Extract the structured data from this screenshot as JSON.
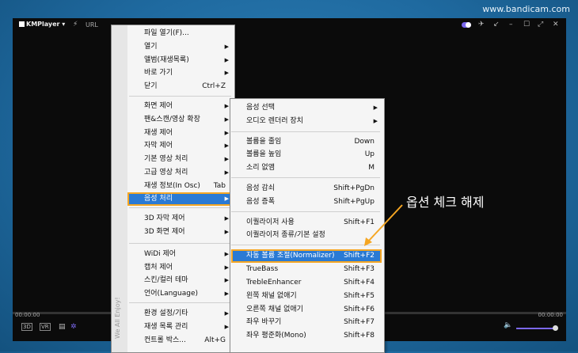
{
  "watermark": "www.bandicam.com",
  "titlebar": {
    "app_name": "KMPlayer",
    "url_label": "URL"
  },
  "player": {
    "time_elapsed": "00:00:00",
    "time_total": "00:00:00",
    "btn_3d": "3D",
    "btn_vr": "VR",
    "volume_fraction": 0.95,
    "accent_color": "#7b68ee"
  },
  "main_menu": {
    "vertical_text": "We All Enjoy!",
    "items": [
      {
        "label": "파일 열기(F)...",
        "shortcut": "",
        "arrow": ""
      },
      {
        "label": "열기",
        "shortcut": "",
        "arrow": "▶"
      },
      {
        "label": "앨범(재생목록)",
        "shortcut": "",
        "arrow": "▶"
      },
      {
        "label": "바로 가기",
        "shortcut": "",
        "arrow": "▶"
      },
      {
        "label": "닫기",
        "shortcut": "Ctrl+Z",
        "arrow": ""
      },
      {
        "label": "화면 제어",
        "shortcut": "",
        "arrow": "▶"
      },
      {
        "label": "팬&스캔/영상 확장",
        "shortcut": "",
        "arrow": "▶"
      },
      {
        "label": "재생 제어",
        "shortcut": "",
        "arrow": "▶"
      },
      {
        "label": "자막 제어",
        "shortcut": "",
        "arrow": "▶"
      },
      {
        "label": "기본 영상 처리",
        "shortcut": "",
        "arrow": "▶"
      },
      {
        "label": "고급 영상 처리",
        "shortcut": "",
        "arrow": "▶"
      },
      {
        "label": "재생 정보(In Osc)",
        "shortcut": "Tab",
        "arrow": ""
      },
      {
        "label": "음성 처리",
        "shortcut": "",
        "arrow": "▶"
      },
      {
        "label": "3D 자막 제어",
        "shortcut": "",
        "arrow": "▶"
      },
      {
        "label": "3D 화면 제어",
        "shortcut": "",
        "arrow": "▶"
      },
      {
        "label": "WiDi 제어",
        "shortcut": "",
        "arrow": "▶"
      },
      {
        "label": "캡처 제어",
        "shortcut": "",
        "arrow": "▶"
      },
      {
        "label": "스킨/컬러 테마",
        "shortcut": "",
        "arrow": "▶"
      },
      {
        "label": "언어(Language)",
        "shortcut": "",
        "arrow": "▶"
      },
      {
        "label": "환경 설정/기타",
        "shortcut": "",
        "arrow": "▶"
      },
      {
        "label": "재생 목록 관리",
        "shortcut": "",
        "arrow": "▶"
      },
      {
        "label": "컨트롤 박스...",
        "shortcut": "Alt+G",
        "arrow": ""
      }
    ]
  },
  "audio_menu": {
    "items": [
      {
        "label": "음성 선택",
        "shortcut": "",
        "arrow": "▶"
      },
      {
        "label": "오디오 렌더러 장치",
        "shortcut": "",
        "arrow": "▶"
      },
      {
        "label": "볼륨을 줄임",
        "shortcut": "Down",
        "arrow": ""
      },
      {
        "label": "볼륨을 높임",
        "shortcut": "Up",
        "arrow": ""
      },
      {
        "label": "소리 없앰",
        "shortcut": "M",
        "arrow": ""
      },
      {
        "label": "음성 감쇠",
        "shortcut": "Shift+PgDn",
        "arrow": ""
      },
      {
        "label": "음성 증폭",
        "shortcut": "Shift+PgUp",
        "arrow": ""
      },
      {
        "label": "이퀄라이저 사용",
        "shortcut": "Shift+F1",
        "arrow": ""
      },
      {
        "label": "이퀄라이저 종류/기본 설정",
        "shortcut": "",
        "arrow": ""
      },
      {
        "label": "자동 볼륨 조절(Normalizer)",
        "shortcut": "Shift+F2",
        "arrow": ""
      },
      {
        "label": "TrueBass",
        "shortcut": "Shift+F3",
        "arrow": ""
      },
      {
        "label": "TrebleEnhancer",
        "shortcut": "Shift+F4",
        "arrow": ""
      },
      {
        "label": "왼쪽 채널 없애기",
        "shortcut": "Shift+F5",
        "arrow": ""
      },
      {
        "label": "오른쪽 채널 없애기",
        "shortcut": "Shift+F6",
        "arrow": ""
      },
      {
        "label": "좌우 바꾸기",
        "shortcut": "Shift+F7",
        "arrow": ""
      },
      {
        "label": "좌우 평준화(Mono)",
        "shortcut": "Shift+F8",
        "arrow": ""
      }
    ]
  },
  "annotation": {
    "text": "옵션 체크 해제",
    "color": "#f5a623"
  }
}
